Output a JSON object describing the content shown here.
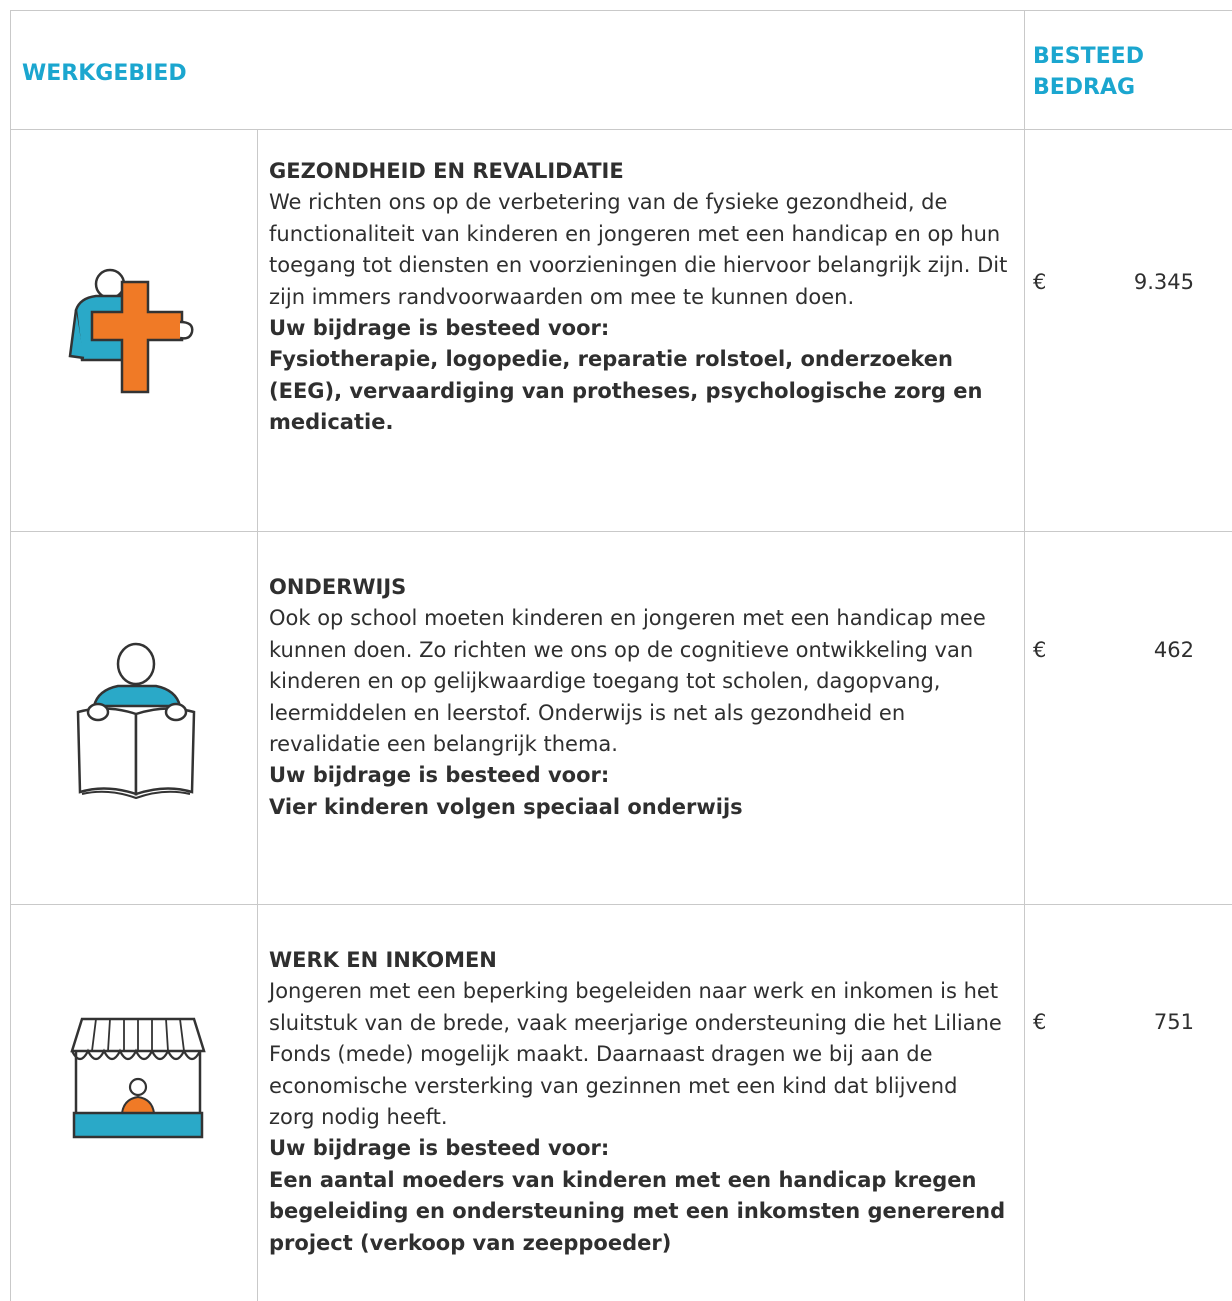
{
  "header": {
    "col1": "WERKGEBIED",
    "col2_line1": "BESTEED",
    "col2_line2": "BEDRAG"
  },
  "rows": [
    {
      "icon": "health-plus-icon",
      "title": "GEZONDHEID EN REVALIDATIE",
      "description": "We richten ons op de verbetering van de fysieke gezondheid, de functionaliteit van kinderen en jongeren met een handicap en op hun toegang tot diensten en voorzieningen die hiervoor belangrijk zijn. Dit zijn immers randvoorwaarden om mee te kunnen doen.",
      "lead": "Uw bijdrage is besteed voor:",
      "spent_on": "Fysiotherapie, logopedie, reparatie rolstoel, onderzoeken (EEG), vervaardiging van protheses, psychologische zorg en medicatie.",
      "currency": "€",
      "amount": "9.345"
    },
    {
      "icon": "education-book-icon",
      "title": "ONDERWIJS",
      "description": "Ook op school moeten kinderen en jongeren met een handicap mee kunnen doen. Zo richten we ons op de cognitieve ontwikkeling van kinderen en op gelijkwaardige toegang tot scholen, dagopvang, leermiddelen en leerstof. Onderwijs is net als gezondheid en revalidatie een belangrijk thema.",
      "lead": "Uw bijdrage is besteed voor:",
      "spent_on": "Vier kinderen volgen speciaal onderwijs",
      "currency": "€",
      "amount": "462"
    },
    {
      "icon": "market-stall-icon",
      "title": "WERK EN INKOMEN",
      "description": "Jongeren met een beperking begeleiden naar werk en inkomen is het sluitstuk van de brede, vaak meerjarige ondersteuning die het Liliane Fonds (mede) mogelijk maakt. Daarnaast dragen we bij aan de economische versterking van gezinnen met een kind dat blijvend zorg nodig heeft.",
      "lead": "Uw bijdrage is besteed voor:",
      "spent_on": "Een aantal moeders van kinderen met een handicap kregen begeleiding en ondersteuning met een inkomsten genererend project (verkoop van zeeppoeder)",
      "currency": "€",
      "amount": "751"
    }
  ],
  "colors": {
    "accent_blue": "#1ba6cf",
    "icon_orange": "#f07a26",
    "icon_teal": "#2aa9c8"
  }
}
